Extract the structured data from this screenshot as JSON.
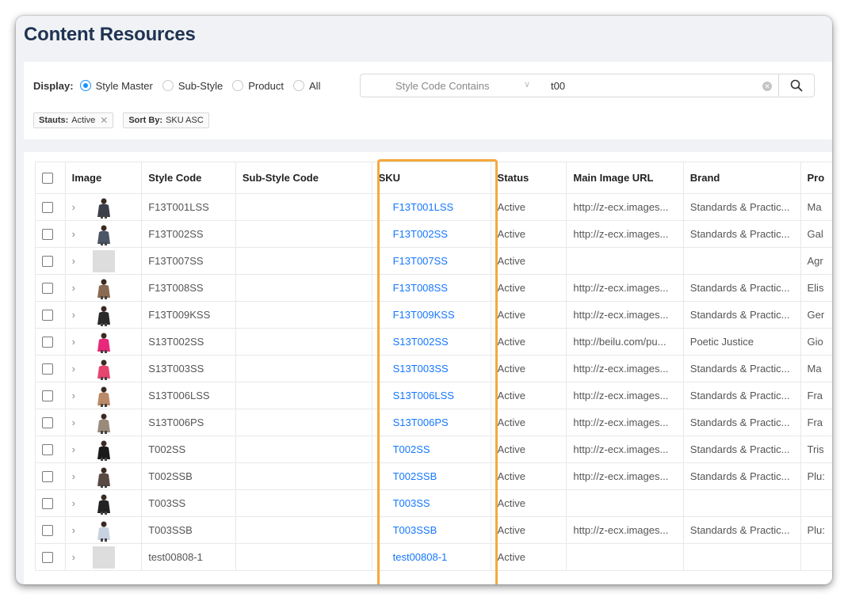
{
  "page": {
    "title": "Content Resources"
  },
  "filters": {
    "display_label": "Display:",
    "options": [
      {
        "label": "Style Master",
        "checked": true
      },
      {
        "label": "Sub-Style",
        "checked": false
      },
      {
        "label": "Product",
        "checked": false
      },
      {
        "label": "All",
        "checked": false
      }
    ],
    "select_value": "Style Code Contains",
    "search_value": "t00",
    "tags": [
      {
        "key": "Stauts:",
        "value": "Active",
        "removable": true
      },
      {
        "key": "Sort By:",
        "value": "SKU ASC",
        "removable": false
      }
    ]
  },
  "table": {
    "columns": [
      "Image",
      "Style Code",
      "Sub-Style Code",
      "SKU",
      "Status",
      "Main Image URL",
      "Brand",
      "Pro"
    ],
    "rows": [
      {
        "thumb": "#3b3f4a",
        "style_code": "F13T001LSS",
        "sub_style": "",
        "sku": "F13T001LSS",
        "status": "Active",
        "url": "http://z-ecx.images...",
        "brand": "Standards & Practic...",
        "pro": "Ma"
      },
      {
        "thumb": "#4a5566",
        "style_code": "F13T002SS",
        "sub_style": "",
        "sku": "F13T002SS",
        "status": "Active",
        "url": "http://z-ecx.images...",
        "brand": "Standards & Practic...",
        "pro": "Gal"
      },
      {
        "thumb": "",
        "style_code": "F13T007SS",
        "sub_style": "",
        "sku": "F13T007SS",
        "status": "Active",
        "url": "",
        "brand": "",
        "pro": "Agr"
      },
      {
        "thumb": "#8a6a52",
        "style_code": "F13T008SS",
        "sub_style": "",
        "sku": "F13T008SS",
        "status": "Active",
        "url": "http://z-ecx.images...",
        "brand": "Standards & Practic...",
        "pro": "Elis"
      },
      {
        "thumb": "#2a2a2a",
        "style_code": "F13T009KSS",
        "sub_style": "",
        "sku": "F13T009KSS",
        "status": "Active",
        "url": "http://z-ecx.images...",
        "brand": "Standards & Practic...",
        "pro": "Ger"
      },
      {
        "thumb": "#e8287a",
        "style_code": "S13T002SS",
        "sub_style": "",
        "sku": "S13T002SS",
        "status": "Active",
        "url": "http://beilu.com/pu...",
        "brand": "Poetic Justice",
        "pro": "Gio"
      },
      {
        "thumb": "#e6456e",
        "style_code": "S13T003SS",
        "sub_style": "",
        "sku": "S13T003SS",
        "status": "Active",
        "url": "http://z-ecx.images...",
        "brand": "Standards & Practic...",
        "pro": "Ma"
      },
      {
        "thumb": "#b98a68",
        "style_code": "S13T006LSS",
        "sub_style": "",
        "sku": "S13T006LSS",
        "status": "Active",
        "url": "http://z-ecx.images...",
        "brand": "Standards & Practic...",
        "pro": "Fra"
      },
      {
        "thumb": "#9a8a7a",
        "style_code": "S13T006PS",
        "sub_style": "",
        "sku": "S13T006PS",
        "status": "Active",
        "url": "http://z-ecx.images...",
        "brand": "Standards & Practic...",
        "pro": "Fra"
      },
      {
        "thumb": "#1a1a1a",
        "style_code": "T002SS",
        "sub_style": "",
        "sku": "T002SS",
        "status": "Active",
        "url": "http://z-ecx.images...",
        "brand": "Standards & Practic...",
        "pro": "Tris"
      },
      {
        "thumb": "#5a4a44",
        "style_code": "T002SSB",
        "sub_style": "",
        "sku": "T002SSB",
        "status": "Active",
        "url": "http://z-ecx.images...",
        "brand": "Standards & Practic...",
        "pro": "Plu:"
      },
      {
        "thumb": "#222222",
        "style_code": "T003SS",
        "sub_style": "",
        "sku": "T003SS",
        "status": "Active",
        "url": "",
        "brand": "",
        "pro": ""
      },
      {
        "thumb": "#c8d2e0",
        "style_code": "T003SSB",
        "sub_style": "",
        "sku": "T003SSB",
        "status": "Active",
        "url": "http://z-ecx.images...",
        "brand": "Standards & Practic...",
        "pro": "Plu:"
      },
      {
        "thumb": "",
        "style_code": "test00808-1",
        "sub_style": "",
        "sku": "test00808-1",
        "status": "Active",
        "url": "",
        "brand": "",
        "pro": ""
      }
    ]
  },
  "colors": {
    "accent": "#1677ff",
    "highlight": "#f4a93b",
    "title": "#1f3352"
  },
  "icons": {
    "search": "search-icon",
    "clear": "clear-icon",
    "expand": "chevron-right-icon",
    "select": "chevron-down-icon"
  }
}
